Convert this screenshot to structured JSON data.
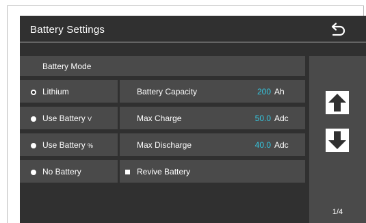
{
  "window": {
    "title": "Battery Settings",
    "back_icon": "return-arrow-icon"
  },
  "panel": {
    "header": "Battery Mode",
    "modes": [
      {
        "label": "Lithium",
        "suffix": "",
        "selected": true
      },
      {
        "label": "Use Battery ",
        "suffix": "V",
        "selected": false
      },
      {
        "label": "Use Battery ",
        "suffix": "%",
        "selected": false
      },
      {
        "label": "No Battery",
        "suffix": "",
        "selected": false
      }
    ],
    "params": [
      {
        "label": "Battery Capacity",
        "value": "200",
        "unit": "Ah"
      },
      {
        "label": "Max Charge",
        "value": "50.0",
        "unit": "Adc"
      },
      {
        "label": "Max Discharge",
        "value": "40.0",
        "unit": "Adc"
      }
    ],
    "revive": {
      "label": "Revive Battery",
      "checked": false
    }
  },
  "nav": {
    "up_icon": "arrow-up-icon",
    "down_icon": "arrow-down-icon",
    "page": "1/4"
  },
  "colors": {
    "background": "#303030",
    "cell": "#4a4a4a",
    "value_accent": "#35c7e0",
    "text": "#ffffff"
  }
}
